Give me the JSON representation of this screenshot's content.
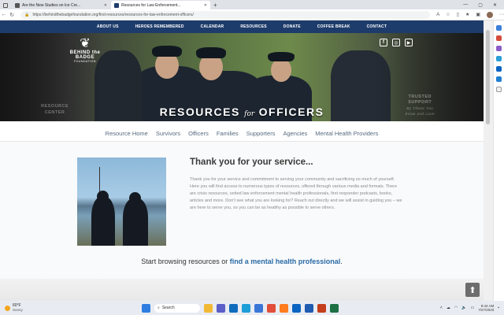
{
  "browser": {
    "tabs": [
      {
        "title": "Are the New Studies on Ice Cre...",
        "active": false,
        "favicon_color": "#555555"
      },
      {
        "title": "Resources for Law Enforcement...",
        "active": true,
        "favicon_color": "#1e3c6b"
      }
    ],
    "new_tab": "+",
    "url": "https://behindthebadgefoundation.org/find-resources/resources-for-law-enforcement-officers/"
  },
  "site": {
    "nav": [
      "ABOUT US",
      "HEROES REMEMBERED",
      "CALENDAR",
      "RESOURCES",
      "DONATE",
      "COFFEE BREAK",
      "CONTACT"
    ],
    "logo": {
      "line1": "BEHIND the",
      "line2": "BADGE",
      "line3": "FOUNDATION"
    },
    "social": [
      {
        "icon": "facebook-icon",
        "glyph": "f"
      },
      {
        "icon": "instagram-icon",
        "glyph": "◎"
      },
      {
        "icon": "youtube-icon",
        "glyph": "▶"
      }
    ],
    "hero": {
      "title_left": "RESOURCES",
      "title_for": "for",
      "title_right": "OFFICERS",
      "left_text_1": "RESOURCE",
      "left_text_2": "CENTER",
      "right_text_1": "TRUSTED",
      "right_text_2": "SUPPORT",
      "right_sub_1": "By Those You",
      "right_sub_2": "Know and Love"
    },
    "sub_nav": [
      "Resource Home",
      "Survivors",
      "Officers",
      "Families",
      "Supporters",
      "Agencies",
      "Mental Health Providers"
    ],
    "intro": {
      "title": "Thank you for your service...",
      "body": "Thank you for your service and commitment to serving your community and sacrificing so much of yourself. Here you will find access to numerous types of resources, offered through various media and formats. There are crisis resources, vetted law enforcement mental health professionals, first responder podcasts, books, articles and more. Don't see what you are looking for? Reach out directly and we will assist in guiding you – we are here to serve you, so you can be as healthy as possible to serve others."
    },
    "cta": {
      "prefix": "Start browsing resources or ",
      "link": "find a mental health professional",
      "suffix": "."
    }
  },
  "taskbar": {
    "weather_temp": "60°F",
    "weather_desc": "Sunny",
    "search_label": "Search",
    "time": "9:44 AM",
    "date": "7/27/2023",
    "apps": [
      {
        "name": "file-explorer-icon",
        "color": "#f2b936"
      },
      {
        "name": "teams-icon",
        "color": "#5b5fc7"
      },
      {
        "name": "mail-icon",
        "color": "#0f6cbd"
      },
      {
        "name": "edge-icon",
        "color": "#1b9ed8"
      },
      {
        "name": "store-icon",
        "color": "#3a76d8"
      },
      {
        "name": "chrome-icon",
        "color": "#e14e3b"
      },
      {
        "name": "firefox-icon",
        "color": "#ff7c1f"
      },
      {
        "name": "outlook-icon",
        "color": "#0a64c2"
      },
      {
        "name": "word-icon",
        "color": "#1f5bb0"
      },
      {
        "name": "powerpoint-icon",
        "color": "#c43e1c"
      },
      {
        "name": "excel-icon",
        "color": "#1d7044"
      }
    ]
  }
}
